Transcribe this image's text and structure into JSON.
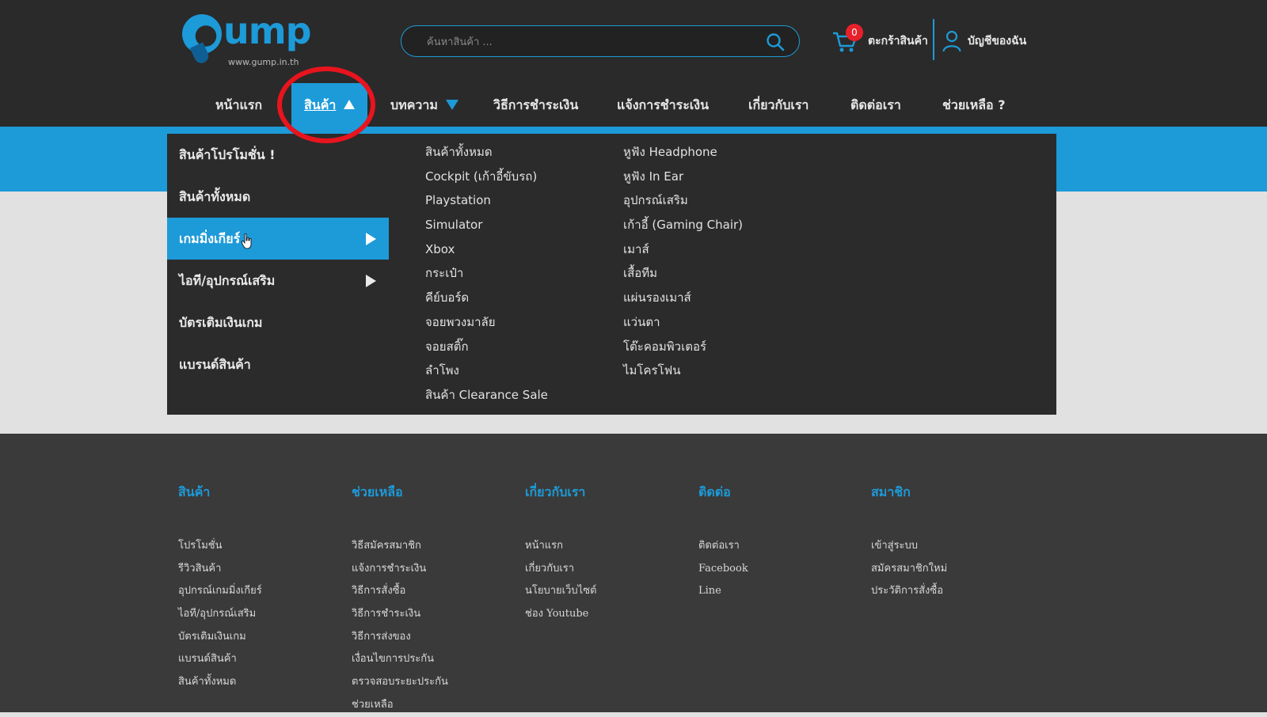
{
  "header": {
    "logo_text": "ump",
    "logo_url": "www.gump.in.th",
    "search_placeholder": "ค้นหาสินค้า ...",
    "cart_count": "0",
    "cart_label": "ตะกร้าสินค้า",
    "account_label": "บัญชีของฉัน"
  },
  "nav": {
    "items": [
      {
        "label": "หน้าแรก"
      },
      {
        "label": "สินค้า"
      },
      {
        "label": "บทความ"
      },
      {
        "label": "วิธีการชำระเงิน"
      },
      {
        "label": "แจ้งการชำระเงิน"
      },
      {
        "label": "เกี่ยวกับเรา"
      },
      {
        "label": "ติดต่อเรา"
      },
      {
        "label": "ช่วยเหลือ ?"
      }
    ]
  },
  "menu": {
    "categories": [
      {
        "label": "สินค้าโปรโมชั่น !"
      },
      {
        "label": "สินค้าทั้งหมด"
      },
      {
        "label": "เกมมิ่งเกียร์"
      },
      {
        "label": "ไอที/อุปกรณ์เสริม"
      },
      {
        "label": "บัตรเติมเงินเกม"
      },
      {
        "label": "แบรนด์สินค้า"
      }
    ],
    "sub_col1": [
      "สินค้าทั้งหมด",
      "Cockpit (เก้าอี้ขับรถ)",
      "Playstation",
      "Simulator",
      "Xbox",
      "กระเป๋า",
      "คีย์บอร์ด",
      "จอยพวงมาลัย",
      "จอยสติ๊ก",
      "ลำโพง",
      "สินค้า Clearance Sale"
    ],
    "sub_col2": [
      "หูฟัง Headphone",
      "หูฟัง In Ear",
      "อุปกรณ์เสริม",
      "เก้าอี้ (Gaming Chair)",
      "เมาส์",
      "เสื้อทีม",
      "แผ่นรองเมาส์",
      "แว่นตา",
      "โต๊ะคอมพิวเตอร์",
      "ไมโครโฟน"
    ]
  },
  "footer": {
    "columns": [
      {
        "title": "สินค้า",
        "links": [
          "โปรโมชั่น",
          "รีวิวสินค้า",
          "อุปกรณ์เกมมิ่งเกียร์",
          "ไอที/อุปกรณ์เสริม",
          "บัตรเติมเงินเกม",
          "แบรนด์สินค้า",
          "สินค้าทั้งหมด"
        ]
      },
      {
        "title": "ช่วยเหลือ",
        "links": [
          "วิธีสมัครสมาชิก",
          "แจ้งการชำระเงิน",
          "วิธีการสั่งซื้อ",
          "วิธีการชำระเงิน",
          "วิธีการส่งของ",
          "เงื่อนไขการประกัน",
          "ตรวจสอบระยะประกัน",
          "ช่วยเหลือ"
        ]
      },
      {
        "title": "เกี่ยวกับเรา",
        "links": [
          "หน้าแรก",
          "เกี่ยวกับเรา",
          "นโยบายเว็บไซต์",
          "ช่อง Youtube"
        ]
      },
      {
        "title": "ติดต่อ",
        "links": [
          "ติดต่อเรา",
          "Facebook",
          "Line"
        ]
      },
      {
        "title": "สมาชิก",
        "links": [
          "เข้าสู่ระบบ",
          "สมัครสมาชิกใหม่",
          "ประวัติการสั่งซื้อ"
        ]
      }
    ]
  },
  "colors": {
    "header_bg": "#2a2a2a",
    "accent_blue": "#1d9ad8",
    "menu_bg": "#2b2b2b",
    "footer_bg": "#3a3a3a",
    "badge_red": "#e8202a",
    "highlight_ring": "#e8141e"
  }
}
